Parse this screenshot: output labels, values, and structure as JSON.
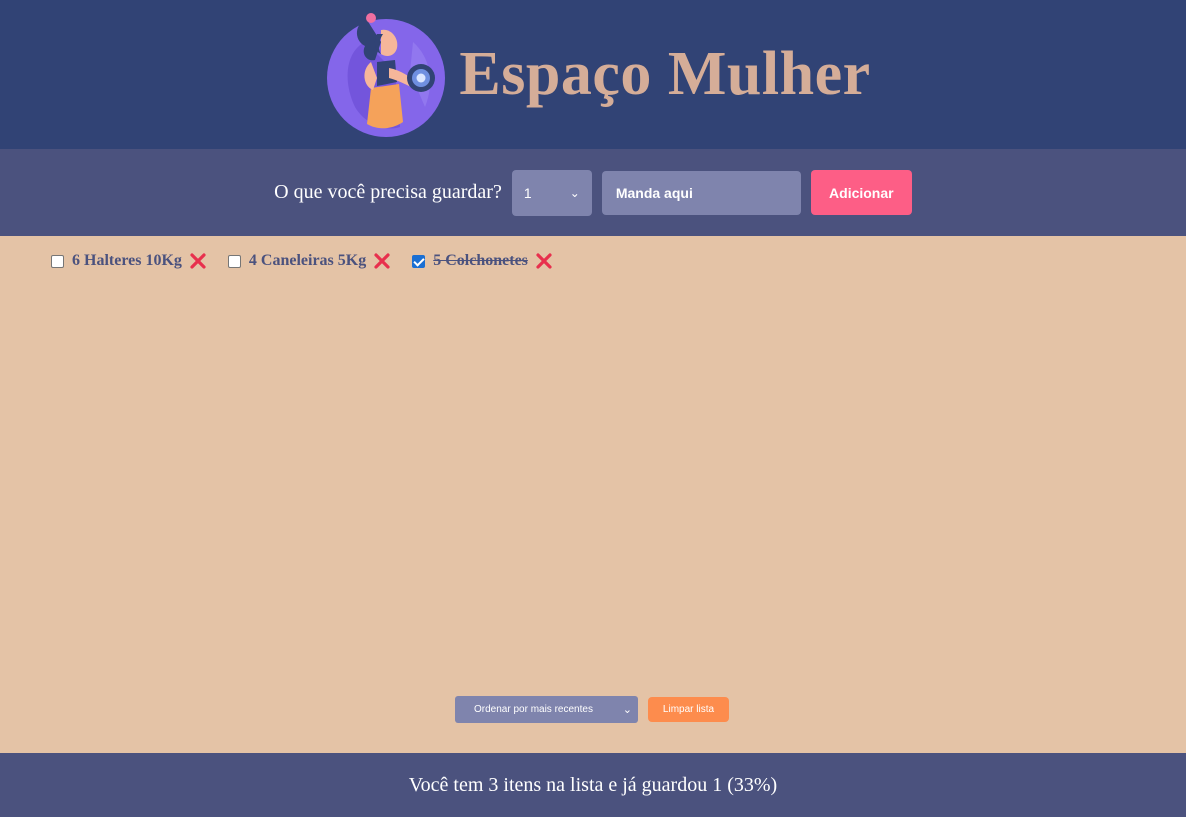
{
  "header": {
    "title": "Espaço Mulher",
    "logo_icon": "woman-dumbbell-logo-icon"
  },
  "form": {
    "label": "O que você precisa guardar?",
    "quantity_value": "1",
    "item_placeholder": "Manda aqui",
    "add_label": "Adicionar"
  },
  "list": {
    "items": [
      {
        "label": "6 Halteres 10Kg",
        "checked": false
      },
      {
        "label": "4 Caneleiras 5Kg",
        "checked": false
      },
      {
        "label": "5 Colchonetes",
        "checked": true
      }
    ]
  },
  "controls": {
    "sort_selected": "Ordenar por mais recentes",
    "clear_label": "Limpar lista"
  },
  "footer": {
    "stats": "Você tem 3 itens na lista e já guardou 1 (33%)"
  },
  "colors": {
    "header_bg": "#314375",
    "form_bg": "#4b527e",
    "body_bg": "#e4c3a6",
    "title": "#d5ad98",
    "accent_pink": "#fd5e86",
    "accent_orange": "#fd8c4d",
    "input_bg": "#7f84ad",
    "delete_icon": "#e8304d"
  }
}
